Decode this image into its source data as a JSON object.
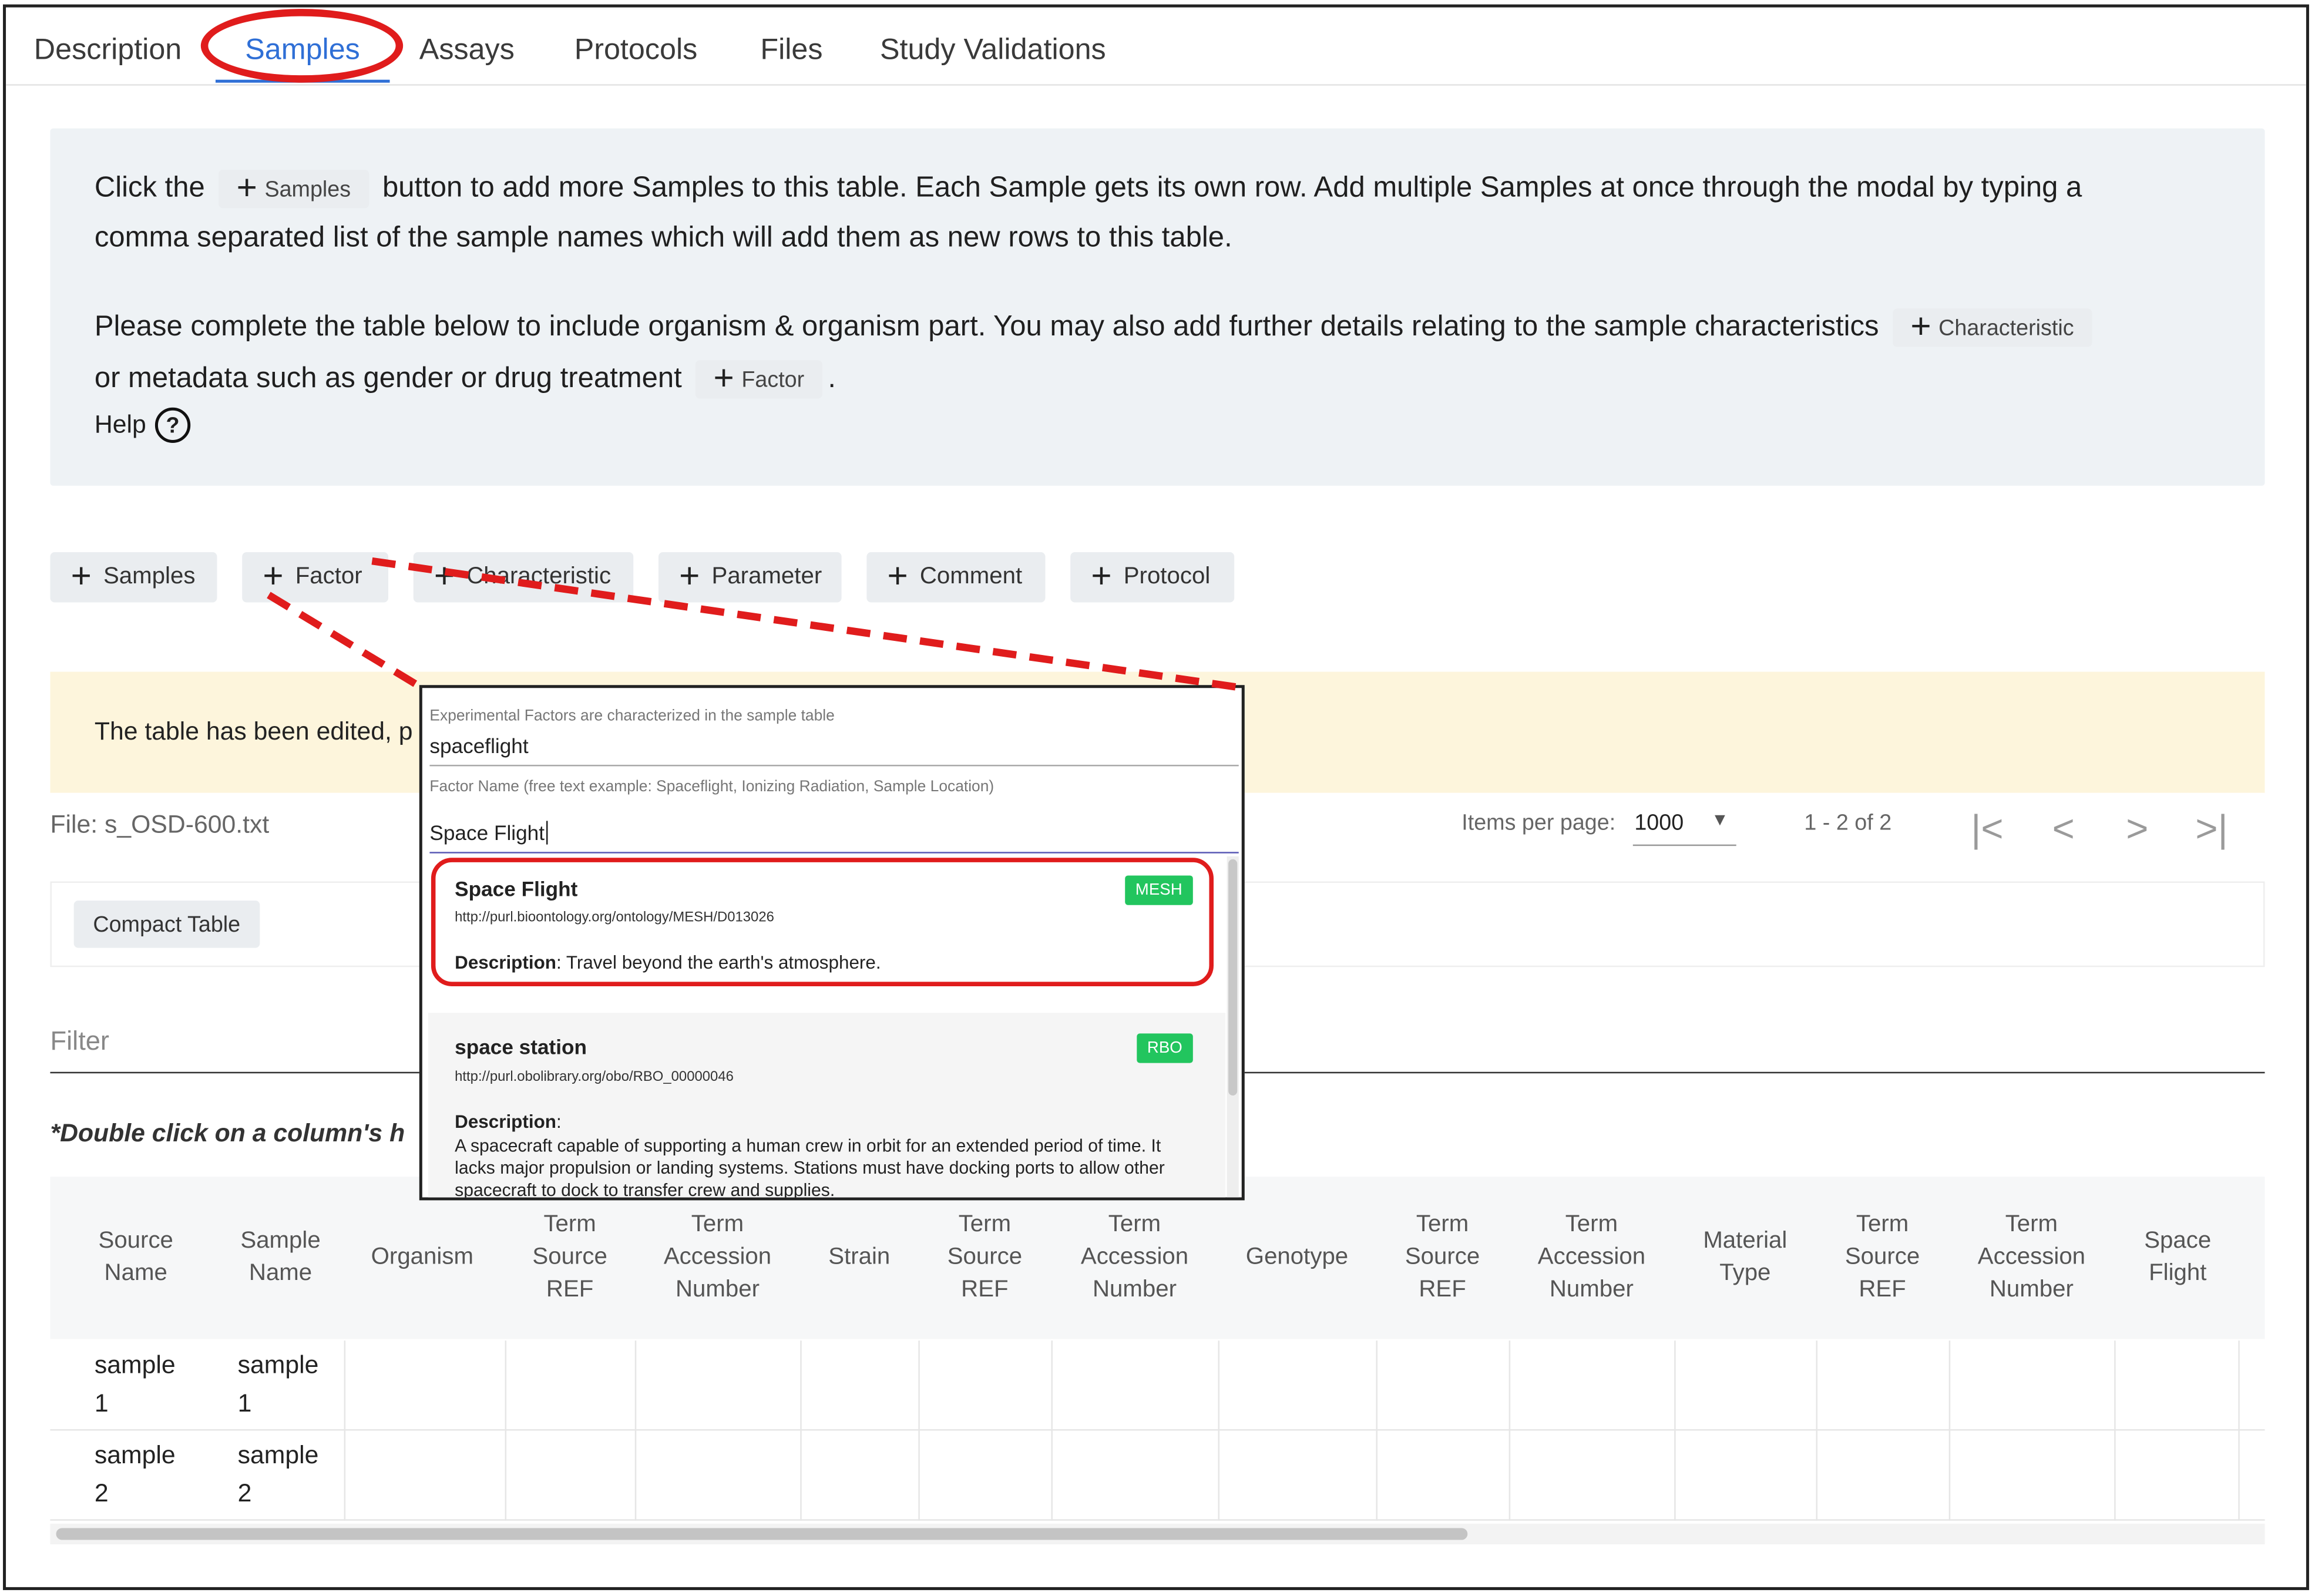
{
  "tabs": [
    {
      "label": "Description"
    },
    {
      "label": "Samples"
    },
    {
      "label": "Assays"
    },
    {
      "label": "Protocols"
    },
    {
      "label": "Files"
    },
    {
      "label": "Study Validations"
    }
  ],
  "info": {
    "line1_pre": "Click the",
    "samples_chip": "Samples",
    "line1_post": "button to add more Samples to this table. Each Sample gets its own row. Add multiple Samples at once through the modal by typing a",
    "line2": "comma separated list of the sample names which will add them as new rows to this table.",
    "line3": "Please complete the table below to include organism & organism part. You may also add further details relating to the sample characteristics",
    "characteristic_chip": "Characteristic",
    "line4": "or metadata such as gender or drug treatment",
    "factor_chip": "Factor",
    "line4_end": ".",
    "help": "Help"
  },
  "actions": {
    "samples": "Samples",
    "factor": "Factor",
    "characteristic": "Characteristic",
    "parameter": "Parameter",
    "comment": "Comment",
    "protocol": "Protocol"
  },
  "warning": "The table has been edited, p",
  "file": "File: s_OSD-600.txt",
  "pager": {
    "items_label": "Items per page:",
    "items_value": "1000",
    "range": "1 - 2 of 2"
  },
  "compact_button": "Compact Table",
  "filter_label": "Filter",
  "hint": "*Double click on a column's h",
  "table": {
    "headers": [
      [
        "Source",
        "Name"
      ],
      [
        "Sample",
        "Name"
      ],
      [
        "Organism"
      ],
      [
        "Term",
        "Source",
        "REF"
      ],
      [
        "Term",
        "Accession",
        "Number"
      ],
      [
        "Strain"
      ],
      [
        "Term",
        "Source",
        "REF"
      ],
      [
        "Term",
        "Accession",
        "Number"
      ],
      [
        "Genotype"
      ],
      [
        "Term",
        "Source",
        "REF"
      ],
      [
        "Term",
        "Accession",
        "Number"
      ],
      [
        "Material",
        "Type"
      ],
      [
        "Term",
        "Source",
        "REF"
      ],
      [
        "Term",
        "Accession",
        "Number"
      ],
      [
        "Space",
        "Flight"
      ]
    ],
    "rows": [
      {
        "source": [
          "sample",
          "1"
        ],
        "sample": [
          "sample",
          "1"
        ]
      },
      {
        "source": [
          "sample",
          "2"
        ],
        "sample": [
          "sample",
          "2"
        ]
      }
    ]
  },
  "popup": {
    "factors_label": "Experimental Factors are characterized in the sample table",
    "factors_value": "spaceflight",
    "name_label": "Factor Name (free text example: Spaceflight, Ionizing Radiation, Sample Location)",
    "name_value": "Space Flight",
    "results": [
      {
        "title": "Space Flight",
        "url": "http://purl.bioontology.org/ontology/MESH/D013026",
        "tag": "MESH",
        "desc_label": "Description",
        "desc": ": Travel beyond the earth's atmosphere."
      },
      {
        "title": "space station",
        "url": "http://purl.obolibrary.org/obo/RBO_00000046",
        "tag": "RBO",
        "desc_label": "Description",
        "desc": ":",
        "desc_body": "A spacecraft capable of supporting a human crew in orbit for an extended period of time. It lacks major propulsion or landing systems. Stations must have docking ports to allow other spacecraft to dock to transfer crew and supplies."
      }
    ]
  },
  "colors": {
    "accent": "#2f6fd6",
    "annotation_red": "#e01c1c",
    "tag_green": "#22c55e",
    "info_bg": "#eef2f5",
    "warning_bg": "#fdf5dc"
  }
}
